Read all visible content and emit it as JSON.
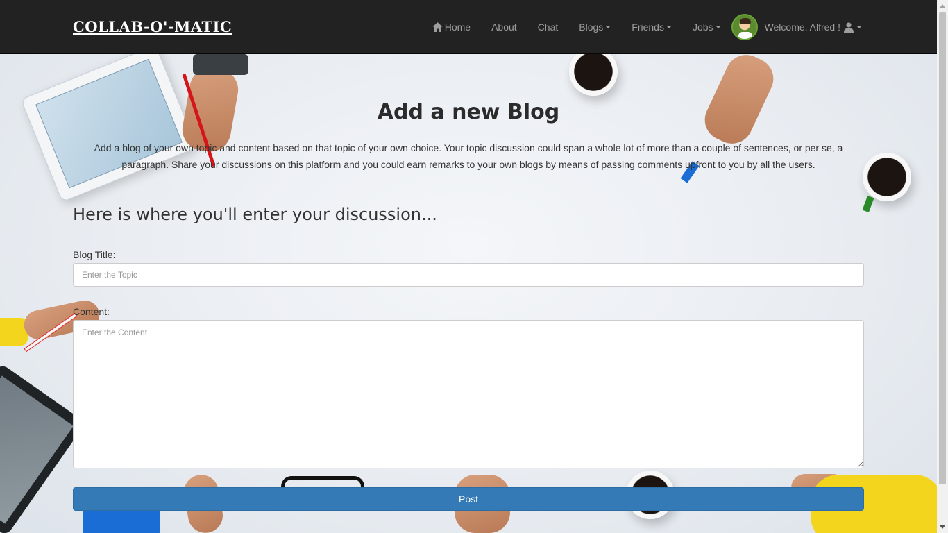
{
  "navbar": {
    "brand": "COLLAB-O'-MATIC",
    "items": [
      {
        "label": "Home",
        "icon": "home-icon"
      },
      {
        "label": "About"
      },
      {
        "label": "Chat"
      },
      {
        "label": "Blogs",
        "dropdown": true
      },
      {
        "label": "Friends",
        "dropdown": true
      },
      {
        "label": "Jobs",
        "dropdown": true
      }
    ],
    "welcome": "Welcome, Alfred !",
    "user_icon": "user-icon"
  },
  "main": {
    "title": "Add a new Blog",
    "intro": "Add a blog of your own topic and content based on that topic of your own choice. Your topic discussion could span a whole lot of more than a couple of sentences, or per se, a paragraph. Share your discussions on this platform and you could earn remarks to your own blogs by means of passing comments upfront to you by all the users.",
    "section_heading": "Here is where you'll enter your discussion...",
    "form": {
      "title_label": "Blog Title:",
      "title_placeholder": "Enter the Topic",
      "content_label": "Content:",
      "content_placeholder": "Enter the Content",
      "submit_label": "Post"
    }
  },
  "colors": {
    "navbar_bg": "#222222",
    "nav_text": "#9d9d9d",
    "primary": "#337ab7"
  }
}
